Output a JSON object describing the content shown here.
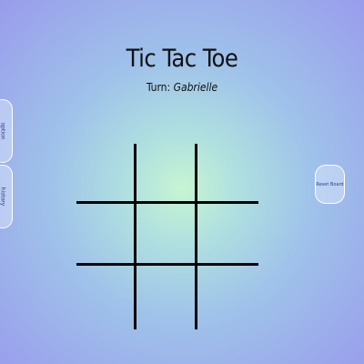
{
  "game": {
    "title": "Tic Tac Toe",
    "turn_label": "Turn:",
    "current_player": "Gabrielle"
  },
  "side_tabs": {
    "option_label": "option",
    "history_label": "history"
  },
  "controls": {
    "reset_label": "Reset Board"
  },
  "board": {
    "cells": [
      "",
      "",
      "",
      "",
      "",
      "",
      "",
      "",
      ""
    ]
  },
  "colors": {
    "background_center": "#c6f5d2",
    "background_edge": "#999cec",
    "grid_lines": "#000000",
    "button_text": "#2d3d8a"
  }
}
